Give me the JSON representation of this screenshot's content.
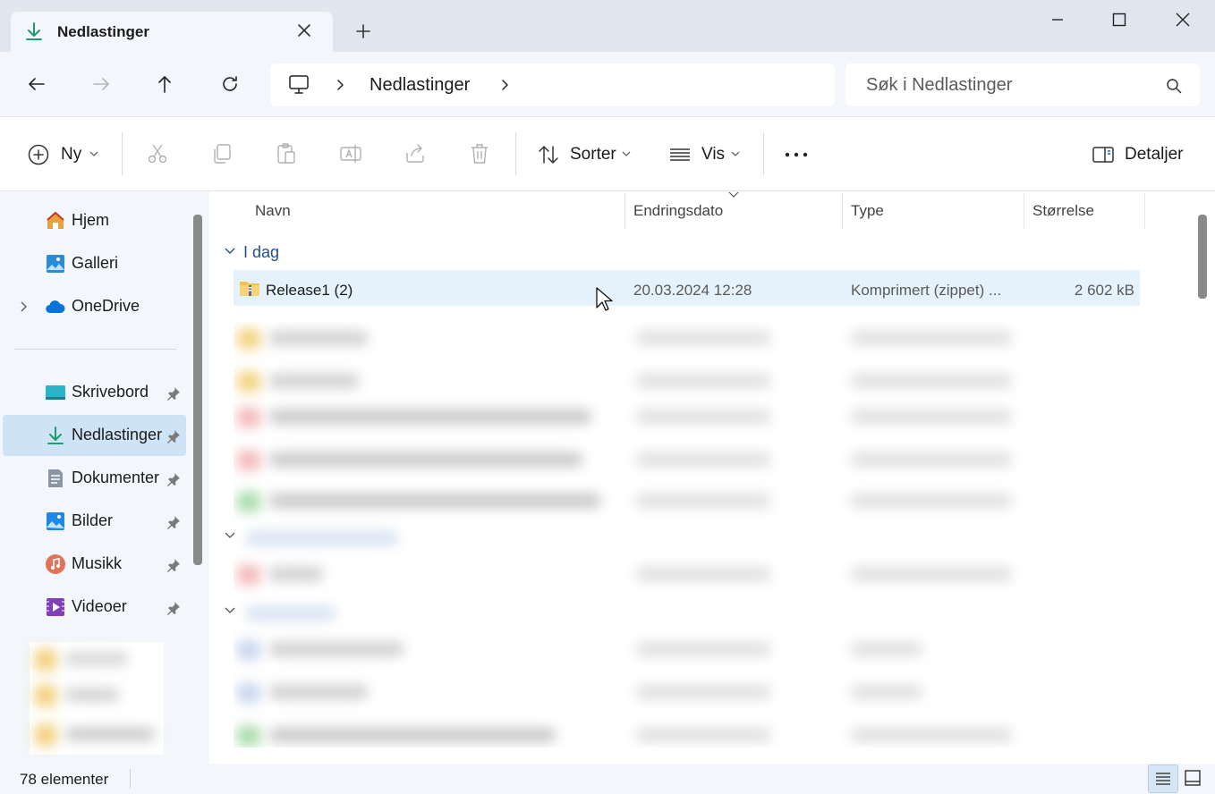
{
  "window": {
    "tab_title": "Nedlastinger",
    "tab_icon": "download-icon",
    "colors": {
      "titlebar": "#dfe6ee",
      "surface": "#f3f6fa",
      "selection": "#cfe3f7",
      "row_hover": "#e5f1fb",
      "accent": "#0067c0"
    }
  },
  "address": {
    "root_icon": "computer-icon",
    "breadcrumb": [
      "Nedlastinger"
    ],
    "search_placeholder": "Søk i Nedlastinger"
  },
  "toolbar": {
    "new_label": "Ny",
    "sort_label": "Sorter",
    "view_label": "Vis",
    "details_label": "Detaljer"
  },
  "sidebar": {
    "items": [
      {
        "label": "Hjem",
        "icon": "home-icon"
      },
      {
        "label": "Galleri",
        "icon": "gallery-icon"
      },
      {
        "label": "OneDrive",
        "icon": "cloud-icon"
      },
      {
        "label": "Skrivebord",
        "icon": "desktop-icon"
      },
      {
        "label": "Nedlastinger",
        "icon": "download-icon"
      },
      {
        "label": "Dokumenter",
        "icon": "document-icon"
      },
      {
        "label": "Bilder",
        "icon": "pictures-icon"
      },
      {
        "label": "Musikk",
        "icon": "music-icon"
      },
      {
        "label": "Videoer",
        "icon": "video-icon"
      }
    ]
  },
  "content": {
    "columns": [
      "Navn",
      "Endringsdato",
      "Type",
      "Størrelse"
    ],
    "group_label": "I dag",
    "file": {
      "name": "Release1 (2)",
      "date": "20.03.2024 12:28",
      "type": "Komprimert (zippet) ...",
      "size": "2 602 kB"
    }
  },
  "status": {
    "count": "78 elementer"
  }
}
